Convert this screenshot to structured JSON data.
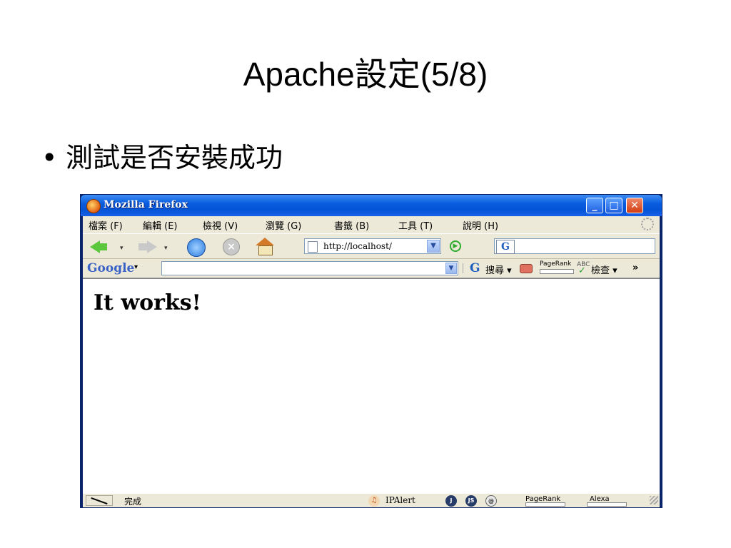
{
  "slide": {
    "title": "Apache設定(5/8)",
    "bullet": "測試是否安裝成功"
  },
  "window": {
    "title": "Mozilla Firefox",
    "menu": [
      "檔案 (F)",
      "編輯 (E)",
      "檢視 (V)",
      "瀏覽 (G)",
      "書籤 (B)",
      "工具 (T)",
      "說明 (H)"
    ],
    "address": "http://localhost/",
    "search_engine_glyph": "G",
    "google_toolbar": {
      "logo": "Google",
      "search_label": "搜尋",
      "pagerank_label": "PageRank",
      "spell_label": "ABC",
      "check_label": "檢查",
      "more": "»"
    },
    "page_content": "It works!",
    "status": {
      "text": "完成",
      "ipalert": "IPAlert",
      "icon_j": "J",
      "icon_js": "JS",
      "icon_at": "@",
      "pagerank": "PageRank",
      "alexa": "Alexa"
    }
  },
  "colors": {
    "titlebar": "#0554d6",
    "back_arrow": "#5cc63c",
    "close_button": "#d23c10"
  }
}
